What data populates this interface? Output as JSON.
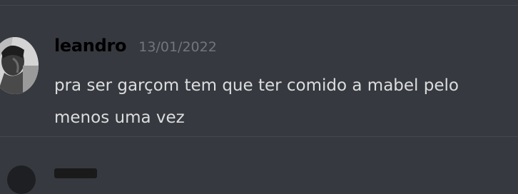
{
  "message": {
    "author": "leandro",
    "timestamp": "13/01/2022",
    "lines": [
      "pra ser garçom tem que ter comido a mabel pelo",
      "menos uma vez"
    ]
  },
  "colors": {
    "background": "#36393f",
    "username": "#000000",
    "timestamp": "#72767d",
    "text": "#dcddde",
    "divider": "#44474d"
  }
}
